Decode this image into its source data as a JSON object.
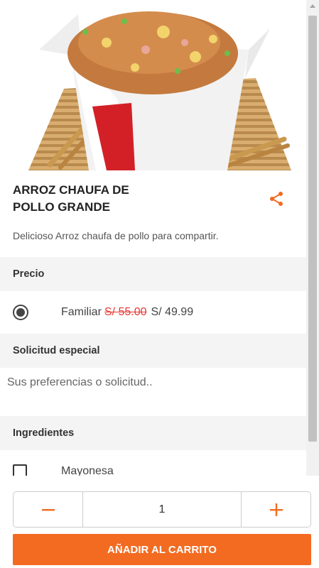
{
  "product": {
    "title_line1": "ARROZ CHAUFA DE",
    "title_line2": "POLLO GRANDE",
    "description": "Delicioso Arroz chaufa de pollo para compartir."
  },
  "price_section": {
    "header": "Precio",
    "option_label": "Familiar",
    "old_price": "S/ 55.00",
    "new_price": "S/ 49.99",
    "selected": true
  },
  "special_section": {
    "header": "Solicitud especial",
    "placeholder": "Sus preferencias o solicitud..",
    "value": ""
  },
  "ingredients_section": {
    "header": "Ingredientes",
    "items": [
      {
        "label": "Mayonesa",
        "checked": false
      }
    ]
  },
  "quantity": {
    "value": "1",
    "decrement_icon": "minus-icon",
    "increment_icon": "plus-icon"
  },
  "add_to_cart": {
    "label": "AÑADIR AL CARRITO"
  },
  "colors": {
    "accent": "#f26b21",
    "old_price": "#e53935",
    "section_bg": "#f4f4f4"
  },
  "icons": {
    "share": "share-icon"
  }
}
